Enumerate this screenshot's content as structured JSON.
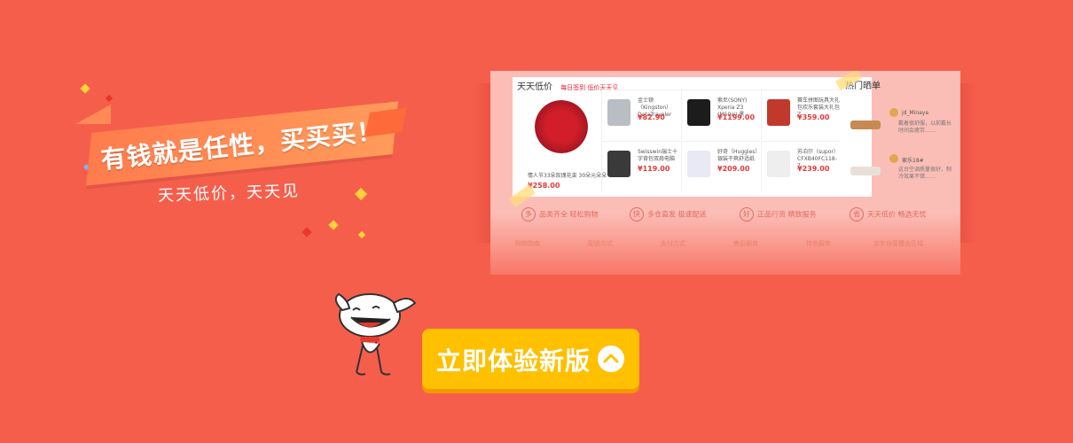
{
  "slogan": {
    "main": "有钱就是任性，买买买！",
    "sub": "天天低价，天天见"
  },
  "cta": {
    "label": "立即体验新版"
  },
  "preview": {
    "section_title": "天天低价",
    "section_subtitle": "每日签到 低价天天见",
    "hot_title": "热门晒单",
    "featured": {
      "name": "情人节33朵玫瑰花束 30朵元朵朵",
      "price": "¥258.00"
    },
    "products": [
      {
        "name": "金士顿（Kingston）DataTraveler",
        "price": "¥82.90",
        "color": "#b9bec5"
      },
      {
        "name": "索尼(SONY) Xperia Z3 (M50w) 黑",
        "price": "¥1199.00",
        "color": "#1c1c1c"
      },
      {
        "name": "赛车拼图玩具大礼包欢乐套装大礼包Z",
        "price": "¥359.00",
        "color": "#c0392b"
      },
      {
        "name": "Swisswin瑞士十字背包双肩电脑",
        "price": "¥119.00",
        "color": "#3a3a3a"
      },
      {
        "name": "好奇（Huggies）银装干爽舒适纸",
        "price": "¥209.00",
        "color": "#e9e9f5"
      },
      {
        "name": "苏泊尔（supor）CFXB40FC118-7",
        "price": "¥239.00",
        "color": "#eeeeee"
      }
    ],
    "hot_items": [
      {
        "user": "jd_Minaya",
        "quote": "戴着很舒服，以前戴长时间会疲劳……"
      },
      {
        "user": "家乐18#",
        "quote": "这台空调质量很好，制冷效果不错……"
      }
    ],
    "features": [
      {
        "icon": "多",
        "text": "品类齐全 轻松购物"
      },
      {
        "icon": "快",
        "text": "多仓直发 极速配送"
      },
      {
        "icon": "好",
        "text": "正品行货 精致服务"
      },
      {
        "icon": "省",
        "text": "天天低价 畅选无忧"
      }
    ],
    "footer_columns": [
      "购物指南",
      "配送方式",
      "支付方式",
      "售后服务",
      "特色服务",
      "京东自营覆盖区域"
    ]
  },
  "colors": {
    "background": "#f65e4c",
    "cta": "#ffc000",
    "price": "#e4393c"
  }
}
